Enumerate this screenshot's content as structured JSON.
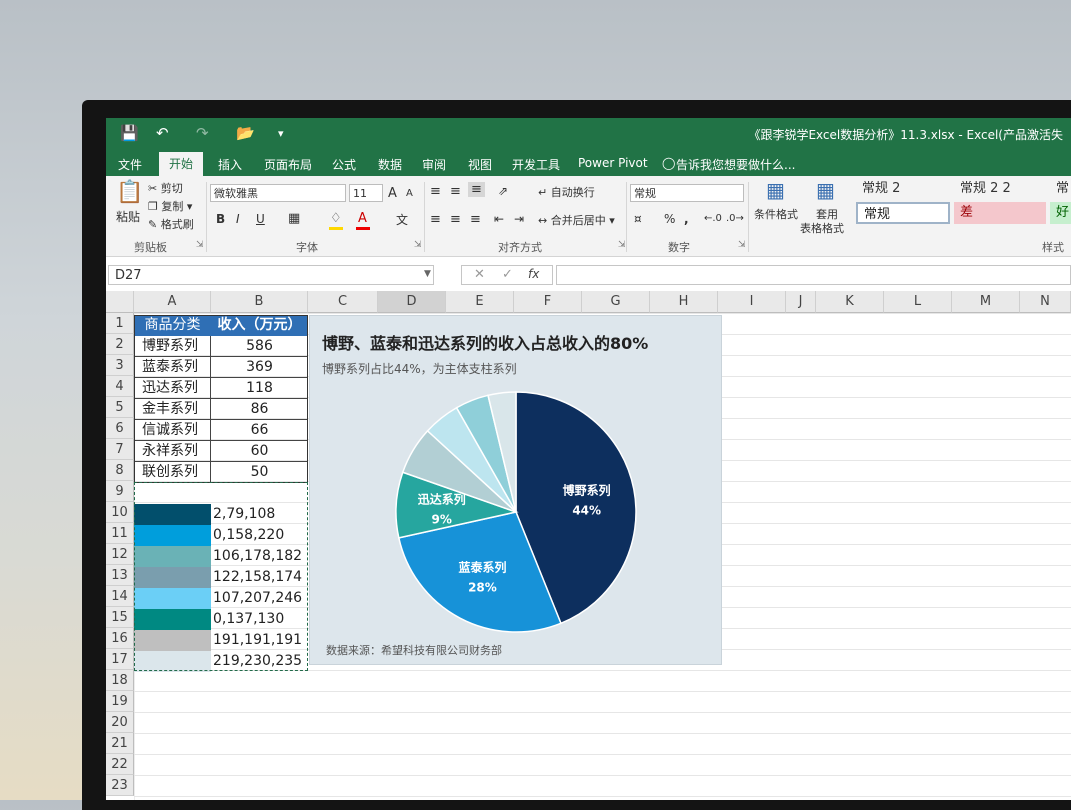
{
  "window": {
    "title": "《跟李锐学Excel数据分析》11.3.xlsx - Excel(产品激活失"
  },
  "tabs": [
    "文件",
    "开始",
    "插入",
    "页面布局",
    "公式",
    "数据",
    "审阅",
    "视图",
    "开发工具",
    "Power Pivot"
  ],
  "active_tab": "开始",
  "tell_me": "告诉我您想要做什么...",
  "ribbon": {
    "clipboard": {
      "paste": "粘贴",
      "cut": "剪切",
      "copy": "复制",
      "format_painter": "格式刷",
      "label": "剪贴板"
    },
    "font": {
      "name": "微软雅黑",
      "size": "11",
      "grow": "A",
      "shrink": "A",
      "bold": "B",
      "italic": "I",
      "underline": "U",
      "label": "字体"
    },
    "alignment": {
      "wrap": "自动换行",
      "merge": "合并后居中",
      "label": "对齐方式"
    },
    "number": {
      "format": "常规",
      "percent": "%",
      "comma": ",",
      "label": "数字"
    },
    "styles": {
      "conditional": "条件格式",
      "table_line1": "套用",
      "table_line2": "表格格式",
      "cells": [
        "常规 2",
        "常规 2 2",
        "常",
        "常规",
        "差",
        "好"
      ],
      "label": "样式"
    }
  },
  "name_box": "D27",
  "fx_label": "fx",
  "columns": [
    "A",
    "B",
    "C",
    "D",
    "E",
    "F",
    "G",
    "H",
    "I",
    "J",
    "K",
    "L",
    "M",
    "N"
  ],
  "rows": [
    "1",
    "2",
    "3",
    "4",
    "5",
    "6",
    "7",
    "8",
    "9",
    "10",
    "11",
    "12",
    "13",
    "14",
    "15",
    "16",
    "17",
    "18",
    "19",
    "20",
    "21",
    "22",
    "23"
  ],
  "table": {
    "headers": [
      "商品分类",
      "收入（万元）"
    ],
    "items": [
      {
        "name": "博野系列",
        "value": "586"
      },
      {
        "name": "蓝泰系列",
        "value": "369"
      },
      {
        "name": "迅达系列",
        "value": "118"
      },
      {
        "name": "金丰系列",
        "value": "86"
      },
      {
        "name": "信诚系列",
        "value": "66"
      },
      {
        "name": "永祥系列",
        "value": "60"
      },
      {
        "name": "联创系列",
        "value": "50"
      }
    ]
  },
  "palette": [
    {
      "rgb": "2,79,108",
      "color": "#024f6c"
    },
    {
      "rgb": "0,158,220",
      "color": "#009edc"
    },
    {
      "rgb": "106,178,182",
      "color": "#6ab2b6"
    },
    {
      "rgb": "122,158,174",
      "color": "#7a9eae"
    },
    {
      "rgb": "107,207,246",
      "color": "#6bcff6"
    },
    {
      "rgb": "0,137,130",
      "color": "#008982"
    },
    {
      "rgb": "191,191,191",
      "color": "#bfbfbf"
    },
    {
      "rgb": "219,230,235",
      "color": "#dbe6eb"
    }
  ],
  "chart_data": {
    "type": "pie",
    "title": "博野、蓝泰和迅达系列的收入占总收入的80%",
    "subtitle": "博野系列占比44%，为主体支柱系列",
    "source": "数据来源：希望科技有限公司财务部",
    "slices": [
      {
        "name": "博野系列",
        "value": 586,
        "label": "44%",
        "color": "#0d2f5e"
      },
      {
        "name": "蓝泰系列",
        "value": 369,
        "label": "28%",
        "color": "#1792d8"
      },
      {
        "name": "迅达系列",
        "value": 118,
        "label": "9%",
        "color": "#26a69f"
      },
      {
        "name": "金丰系列",
        "value": 86,
        "color": "#b2cfd4"
      },
      {
        "name": "信诚系列",
        "value": 66,
        "color": "#bde5ef"
      },
      {
        "name": "永祥系列",
        "value": 60,
        "color": "#8fcfd9"
      },
      {
        "name": "联创系列",
        "value": 50,
        "color": "#d9e6ea"
      }
    ]
  }
}
